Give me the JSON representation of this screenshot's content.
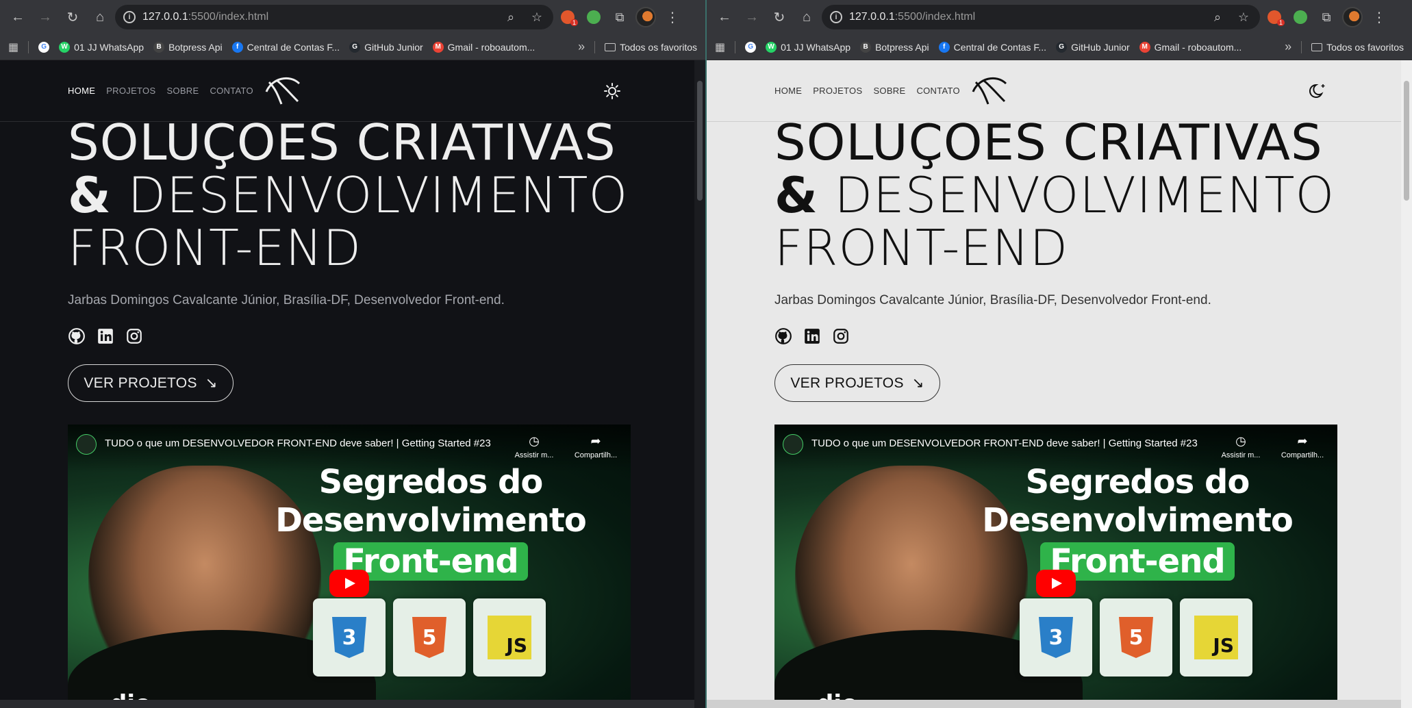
{
  "browser": {
    "url_host": "127.0.0.1",
    "url_path": ":5500/index.html",
    "extension_badge": "1",
    "bookmarks": [
      {
        "label": "01 JJ WhatsApp",
        "color": "#25d366",
        "glyph": "W"
      },
      {
        "label": "Botpress Api",
        "color": "#444444",
        "glyph": "B"
      },
      {
        "label": "Central de Contas F...",
        "color": "#1877f2",
        "glyph": "f"
      },
      {
        "label": "GitHub Junior",
        "color": "#24292f",
        "glyph": "G"
      },
      {
        "label": "Gmail - roboautom...",
        "color": "#ea4335",
        "glyph": "M"
      }
    ],
    "all_bookmarks_label": "Todos os favoritos"
  },
  "site": {
    "nav": [
      "HOME",
      "PROJETOS",
      "SOBRE",
      "CONTATO"
    ],
    "hero_line1": "SOLUÇÕES CRIATIVAS",
    "hero_amp": "&",
    "hero_line2_rest": " DESENVOLVIMENTO",
    "hero_line3": "FRONT-END",
    "subtitle": "Jarbas Domingos Cavalcante Júnior, Brasília-DF, Desenvolvedor Front-end.",
    "cta_label": "VER PROJETOS",
    "cta_arrow": "↘",
    "social_icons": [
      "github-icon",
      "linkedin-icon",
      "instagram-icon"
    ],
    "video": {
      "title": "TUDO o que um DESENVOLVEDOR FRONT-END deve saber! | Getting Started #23",
      "watch_later": "Assistir m...",
      "share": "Compartilh...",
      "headline_1": "Segredos do",
      "headline_2": "Desenvolvimento",
      "headline_3": "Front-end",
      "css_badge": "3",
      "html_badge": "5",
      "js_badge": "JS",
      "brand": "dio."
    }
  },
  "themes": {
    "left": "dark",
    "right": "light"
  }
}
